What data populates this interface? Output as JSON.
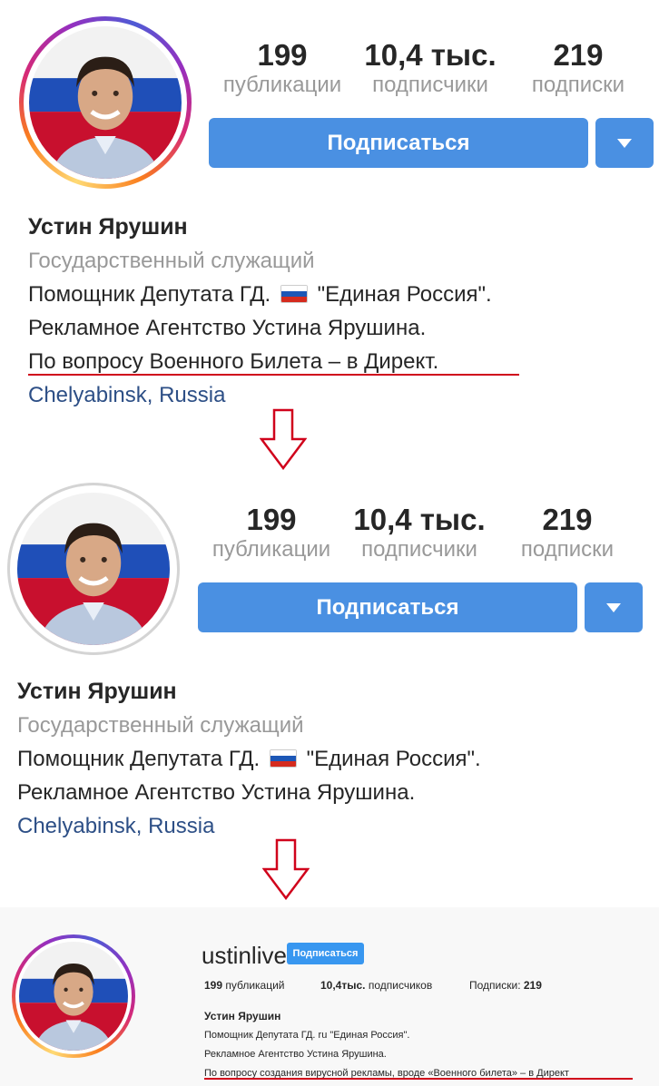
{
  "colors": {
    "accent_blue": "#4a90e2",
    "muted_gray": "#999999",
    "location_blue": "#2d4f86",
    "underline_red": "#d0021b",
    "web_button": "#3897f0"
  },
  "panel1": {
    "stats": [
      {
        "number": "199",
        "label": "публикации"
      },
      {
        "number": "10,4 тыс.",
        "label": "подписчики"
      },
      {
        "number": "219",
        "label": "подписки"
      }
    ],
    "follow_label": "Подписаться",
    "dropdown_icon": "caret-down-icon",
    "name": "Устин Ярушин",
    "category": "Государственный служащий",
    "bio_line1_prefix": "Помощник Депутата ГД.",
    "bio_line1_suffix": "\"Единая Россия\".",
    "bio_line2": "Рекламное Агентство Устина Ярушина.",
    "bio_line3": "По вопросу Военного Билета – в Директ",
    "bio_line3_tail": ".",
    "location": "Chelyabinsk, Russia"
  },
  "panel2": {
    "stats": [
      {
        "number": "199",
        "label": "публикации"
      },
      {
        "number": "10,4 тыс.",
        "label": "подписчики"
      },
      {
        "number": "219",
        "label": "подписки"
      }
    ],
    "follow_label": "Подписаться",
    "dropdown_icon": "caret-down-icon",
    "name": "Устин Ярушин",
    "category": "Государственный служащий",
    "bio_line1_prefix": "Помощник Депутата ГД.",
    "bio_line1_suffix": "\"Единая Россия\".",
    "bio_line2": "Рекламное Агентство Устина Ярушина.",
    "location": "Chelyabinsk, Russia"
  },
  "panel3": {
    "username": "ustinlive",
    "follow_label": "Подписаться",
    "posts_num": "199",
    "posts_label": "публикаций",
    "followers_num": "10,4тыс.",
    "followers_label": "подписчиков",
    "following_label": "Подписки:",
    "following_num": "219",
    "name": "Устин Ярушин",
    "bio_line1": "Помощник Депутата ГД. ru \"Единая Россия\".",
    "bio_line2": "Рекламное Агентство Устина Ярушина.",
    "bio_line3": "По вопросу создания вирусной рекламы, вроде «Военного билета» – в Директ"
  }
}
